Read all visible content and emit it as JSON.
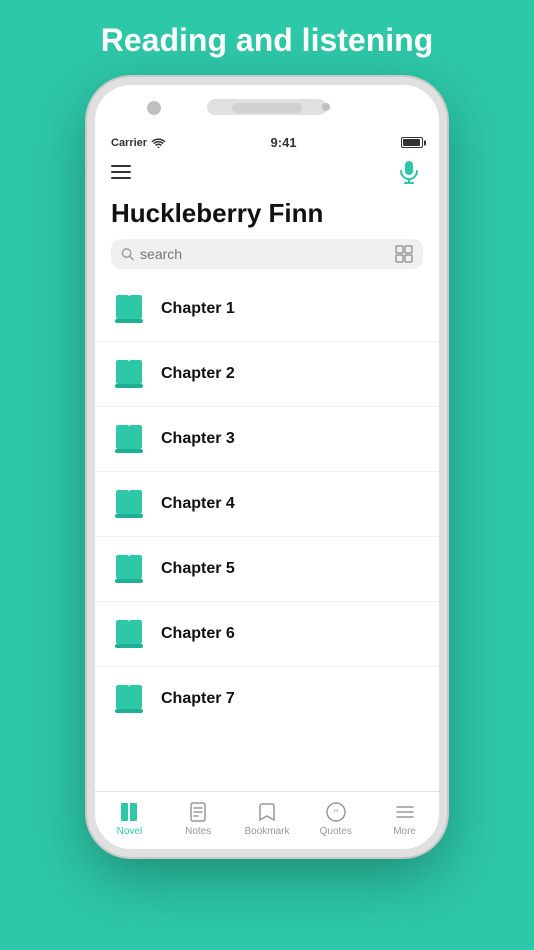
{
  "header": {
    "title": "Reading and listening"
  },
  "status_bar": {
    "carrier": "Carrier",
    "time": "9:41"
  },
  "book": {
    "title": "Huckleberry Finn"
  },
  "search": {
    "placeholder": "search"
  },
  "chapters": [
    {
      "id": 1,
      "name": "Chapter 1"
    },
    {
      "id": 2,
      "name": "Chapter 2"
    },
    {
      "id": 3,
      "name": "Chapter 3"
    },
    {
      "id": 4,
      "name": "Chapter 4"
    },
    {
      "id": 5,
      "name": "Chapter 5"
    },
    {
      "id": 6,
      "name": "Chapter 6"
    },
    {
      "id": 7,
      "name": "Chapter 7"
    }
  ],
  "tabs": [
    {
      "id": "novel",
      "label": "Novel",
      "active": true
    },
    {
      "id": "notes",
      "label": "Notes",
      "active": false
    },
    {
      "id": "bookmark",
      "label": "Bookmark",
      "active": false
    },
    {
      "id": "quotes",
      "label": "Quotes",
      "active": false
    },
    {
      "id": "more",
      "label": "More",
      "active": false
    }
  ],
  "colors": {
    "teal": "#2DC8A8",
    "background": "#2DC8A8"
  }
}
